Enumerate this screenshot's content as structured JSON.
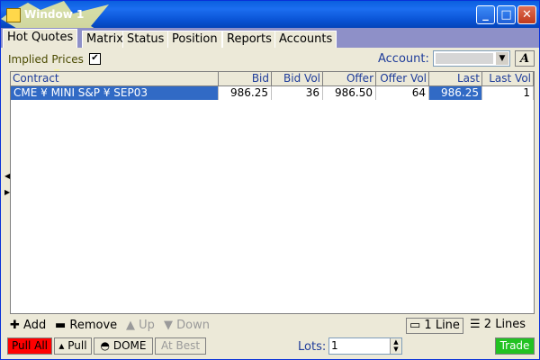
{
  "window": {
    "title": "Window 1"
  },
  "tabs": [
    {
      "label": "Hot Quotes"
    },
    {
      "label": "Matrix"
    },
    {
      "label": "Status"
    },
    {
      "label": "Position"
    },
    {
      "label": "Reports"
    },
    {
      "label": "Accounts"
    }
  ],
  "toolbar": {
    "implied_label": "Implied Prices",
    "implied_checked": "✔",
    "account_label": "Account:",
    "account_value": "",
    "font_button": "A"
  },
  "table": {
    "headers": [
      "Contract",
      "Bid",
      "Bid Vol",
      "Offer",
      "Offer Vol",
      "Last",
      "Last Vol"
    ],
    "rows": [
      [
        "CME ¥ MINI S&P ¥ SEP03",
        "986.25",
        "36",
        "986.50",
        "64",
        "986.25",
        "1"
      ]
    ]
  },
  "actions": {
    "add": "Add",
    "remove": "Remove",
    "up": "Up",
    "down": "Down",
    "one_line": "1 Line",
    "two_lines": "2 Lines"
  },
  "footer": {
    "pull_all": "Pull All",
    "pull": "Pull",
    "dome": "DOME",
    "at_best": "At Best",
    "lots_label": "Lots:",
    "lots_value": "1",
    "trade": "Trade"
  },
  "colors": {
    "titlebar": "#0a5fde",
    "selected_row": "#316ac5",
    "pull_all": "#ff0000",
    "trade": "#22c222",
    "header_text": "#1e3c9a"
  }
}
